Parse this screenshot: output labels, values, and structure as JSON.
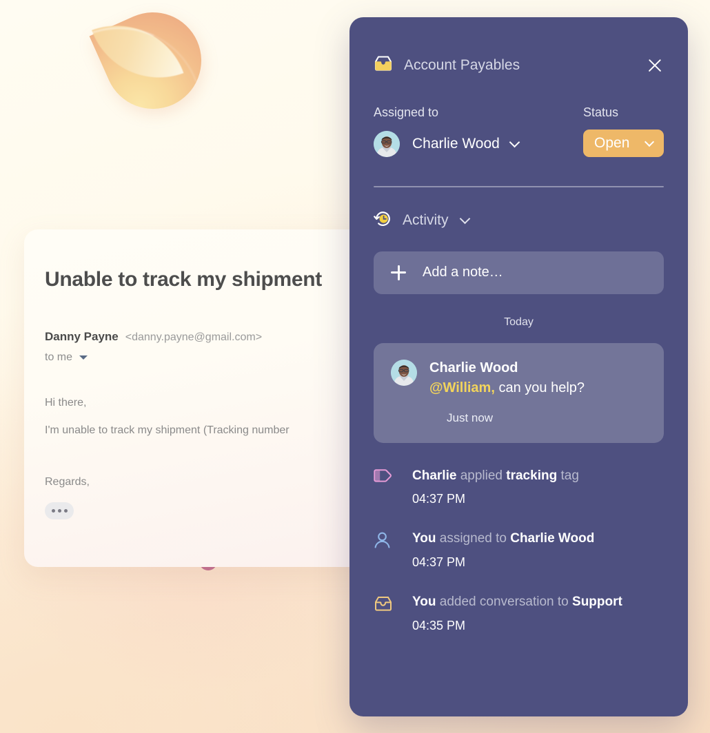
{
  "background": {
    "sphere_icon": "hemisphere-decoration",
    "squiggle_icon": "squiggle-decoration",
    "colors": {
      "page_top": "#FFFCF2",
      "page_bottom": "#F9E0C4"
    }
  },
  "email": {
    "subject": "Unable to track my shipment",
    "from_name": "Danny Payne",
    "from_address": "<danny.payne@gmail.com>",
    "to_label": "to me",
    "body_lines": [
      "Hi there,",
      "I'm unable to track my shipment (Tracking number"
    ],
    "regards": "Regards,",
    "more_button": "…"
  },
  "panel": {
    "colors": {
      "panel_bg": "#4E5080",
      "status_accent": "#EEB868",
      "mention": "#F2D45C"
    },
    "title": "Account Payables",
    "inbox_icon": "inbox-icon",
    "close_icon": "close-icon",
    "assigned_label": "Assigned to",
    "assignee_name": "Charlie Wood",
    "status_label": "Status",
    "status_value": "Open",
    "activity": {
      "icon": "history-clock-icon",
      "label": "Activity",
      "add_note_placeholder": "Add a note…",
      "day_divider": "Today"
    },
    "note": {
      "author": "Charlie Wood",
      "mention": "@William,",
      "text": " can you help?",
      "time": "Just now"
    },
    "log": [
      {
        "icon": "tag-icon",
        "actor": "Charlie",
        "verb": "applied",
        "target": "tracking",
        "suffix": "tag",
        "time": "04:37 PM"
      },
      {
        "icon": "person-icon",
        "actor": "You",
        "verb": "assigned to",
        "target": "Charlie Wood",
        "suffix": "",
        "time": "04:37 PM"
      },
      {
        "icon": "inbox-icon",
        "actor": "You",
        "verb": "added conversation to",
        "target": "Support",
        "suffix": "",
        "time": "04:35 PM"
      }
    ]
  }
}
